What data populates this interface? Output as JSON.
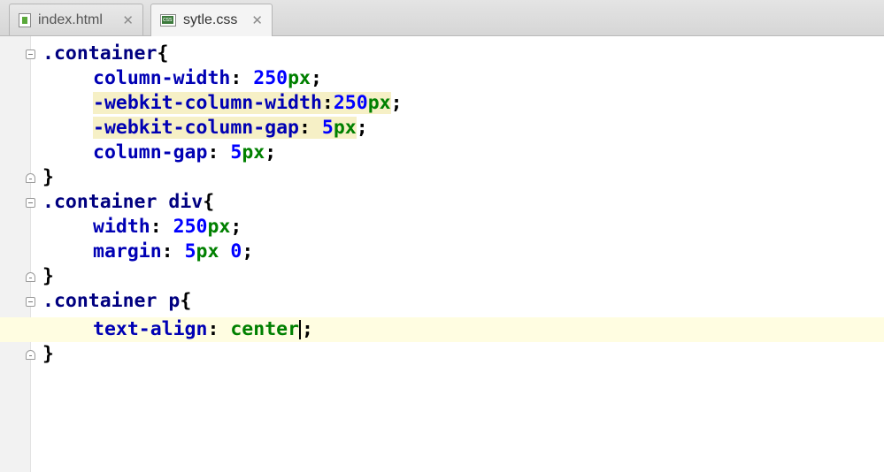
{
  "tabs": [
    {
      "label": "index.html",
      "icon": "html-file-icon",
      "active": false
    },
    {
      "label": "sytle.css",
      "icon": "css-file-icon",
      "active": true
    }
  ],
  "code": {
    "rule1_selector": ".container",
    "rule1_open": "{",
    "p1": "column-width",
    "v1_num": "250",
    "v1_unit": "px",
    "p2": "-webkit-column-width",
    "v2_num": "250",
    "v2_unit": "px",
    "p3": "-webkit-column-gap",
    "v3_num": "5",
    "v3_unit": "px",
    "p4": "column-gap",
    "v4_num": "5",
    "v4_unit": "px",
    "close": "}",
    "rule2_selector": ".container div",
    "p5": "width",
    "v5_num": "250",
    "v5_unit": "px",
    "p6": "margin",
    "v6_num": "5",
    "v6_unit": "px",
    "v6_num2": "0",
    "rule3_selector": ".container p",
    "p7": "text-align",
    "v7_value": "center",
    "colon": ":",
    "semicolon": ";"
  },
  "colors": {
    "selector": "#000080",
    "property": "#0000b4",
    "number": "#0000ff",
    "unit": "#008000",
    "current_line": "#fffde1"
  }
}
